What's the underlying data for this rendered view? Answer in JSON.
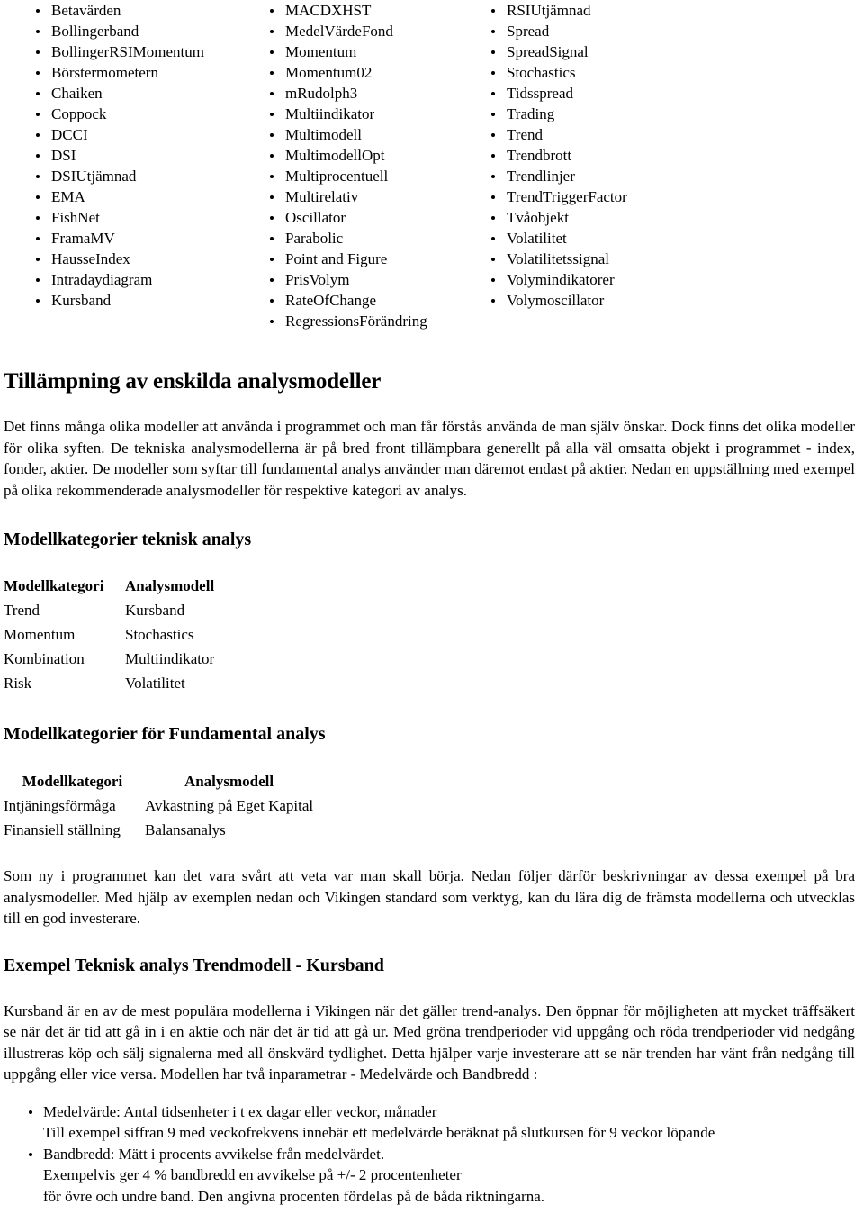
{
  "indicator_columns": [
    {
      "name": "column-1",
      "items": [
        "Betavärden",
        "Bollingerband",
        "BollingerRSIMomentum",
        "Börstermometern",
        "Chaiken",
        "Coppock",
        "DCCI",
        "DSI",
        "DSIUtjämnad",
        "EMA",
        "FishNet",
        "FramaMV",
        "HausseIndex",
        "Intradaydiagram",
        "Kursband"
      ]
    },
    {
      "name": "column-2",
      "items": [
        "MACDXHST",
        "MedelVärdeFond",
        "Momentum",
        "Momentum02",
        "mRudolph3",
        "Multiindikator",
        "Multimodell",
        "MultimodellOpt",
        "Multiprocentuell",
        "Multirelativ",
        "Oscillator",
        "Parabolic",
        "Point and Figure",
        "PrisVolym",
        "RateOfChange",
        "RegressionsFörändring"
      ]
    },
    {
      "name": "column-3",
      "items": [
        "RSIUtjämnad",
        "Spread",
        "SpreadSignal",
        "Stochastics",
        "Tidsspread",
        "Trading",
        "Trend",
        "Trendbrott",
        "Trendlinjer",
        "TrendTriggerFactor",
        "Tvåobjekt",
        "Volatilitet",
        "Volatilitetssignal",
        "Volymindikatorer",
        "Volymoscillator"
      ]
    }
  ],
  "sections": {
    "tillampning": {
      "heading": "Tillämpning av enskilda analysmodeller",
      "paragraph": "Det finns många olika modeller att använda i programmet och man får förstås använda de man själv önskar. Dock finns det olika modeller för olika syften. De tekniska analysmodellerna är på bred front tillämpbara generellt på alla väl omsatta objekt i programmet - index, fonder, aktier. De modeller som syftar till fundamental analys använder man däremot endast på aktier. Nedan en uppställning med exempel på olika rekommenderade analysmodeller för respektive kategori av analys."
    },
    "teknisk_analys": {
      "heading": "Modellkategorier teknisk analys",
      "table": {
        "headers": [
          "Modellkategori",
          "Analysmodell"
        ],
        "rows": [
          [
            "Trend",
            "Kursband"
          ],
          [
            "Momentum",
            "Stochastics"
          ],
          [
            "Kombination",
            "Multiindikator"
          ],
          [
            "Risk",
            "Volatilitet"
          ]
        ]
      }
    },
    "fundamental_analys": {
      "heading": "Modellkategorier för Fundamental analys",
      "table": {
        "headers": [
          "Modellkategori",
          "Analysmodell"
        ],
        "rows": [
          [
            "Intjäningsförmåga",
            "Avkastning på Eget Kapital"
          ],
          [
            "Finansiell ställning",
            "Balansanalys"
          ]
        ]
      }
    },
    "intro_exempel": {
      "paragraph": "Som ny i programmet kan det vara svårt att veta var man skall börja. Nedan följer därför beskrivningar av dessa exempel på bra analysmodeller. Med hjälp av exemplen nedan och Vikingen standard som verktyg, kan du lära dig de främsta modellerna och utvecklas till en god investerare."
    },
    "exempel_kursband": {
      "heading": "Exempel Teknisk analys Trendmodell - Kursband",
      "paragraph": "Kursband är en av de mest populära modellerna i Vikingen när det gäller trend-analys. Den öppnar för möjligheten att mycket träffsäkert se när det är tid att gå in i en aktie och när det är tid att gå ur. Med gröna trendperioder vid uppgång och röda trendperioder vid nedgång illustreras köp och sälj signalerna med all önskvärd tydlighet. Detta hjälper varje investerare att se när trenden har vänt från nedgång till uppgång eller vice versa. Modellen har två inparametrar - Medelvärde och Bandbredd :",
      "parameters": [
        {
          "line1": "Medelvärde: Antal tidsenheter i t ex dagar eller veckor, månader",
          "line2": "Till exempel siffran 9 med veckofrekvens innebär ett medelvärde beräknat på slutkursen för 9 veckor löpande",
          "line3": ""
        },
        {
          "line1": "Bandbredd: Mätt i procents avvikelse från medelvärdet.",
          "line2": "Exempelvis ger 4 % bandbredd en avvikelse på +/- 2 procentenheter",
          "line3": "för övre och undre band. Den angivna procenten fördelas på de båda riktningarna."
        }
      ]
    }
  }
}
